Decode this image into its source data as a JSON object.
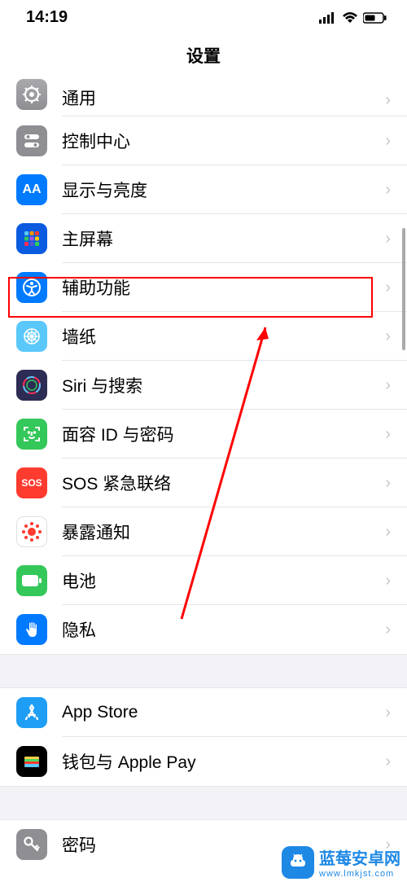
{
  "status": {
    "time": "14:19"
  },
  "header": {
    "title": "设置"
  },
  "rows": [
    {
      "id": "general",
      "label": "通用"
    },
    {
      "id": "control-center",
      "label": "控制中心"
    },
    {
      "id": "display",
      "label": "显示与亮度"
    },
    {
      "id": "home-screen",
      "label": "主屏幕"
    },
    {
      "id": "accessibility",
      "label": "辅助功能"
    },
    {
      "id": "wallpaper",
      "label": "墙纸"
    },
    {
      "id": "siri",
      "label": "Siri 与搜索"
    },
    {
      "id": "faceid",
      "label": "面容 ID 与密码"
    },
    {
      "id": "sos",
      "label": "SOS 紧急联络"
    },
    {
      "id": "exposure",
      "label": "暴露通知"
    },
    {
      "id": "battery",
      "label": "电池"
    },
    {
      "id": "privacy",
      "label": "隐私"
    },
    {
      "id": "appstore",
      "label": "App Store"
    },
    {
      "id": "wallet",
      "label": "钱包与 Apple Pay"
    },
    {
      "id": "passwords",
      "label": "密码"
    }
  ],
  "icon_text": {
    "display": "AA",
    "sos": "SOS"
  },
  "watermark": {
    "brand": "蓝莓安卓网",
    "url": "www.lmkjst.com"
  }
}
